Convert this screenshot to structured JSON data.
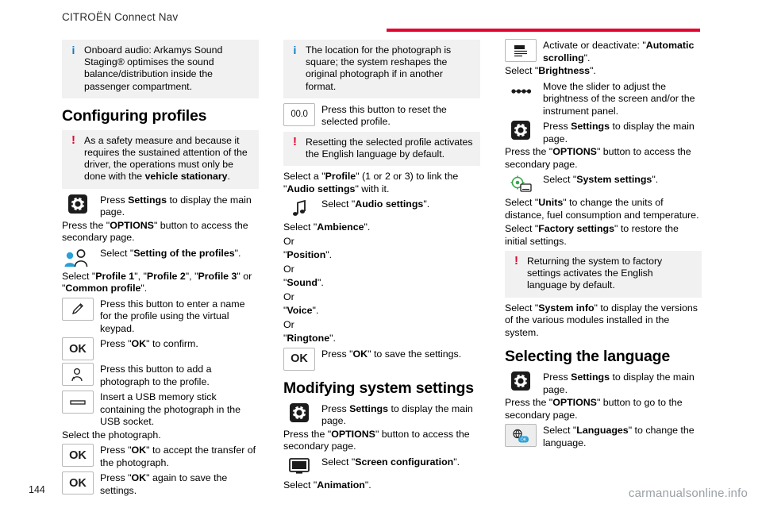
{
  "header": {
    "title": "CITROËN Connect Nav"
  },
  "footer": {
    "page_number": "144",
    "watermark": "carmanualsonline.info"
  },
  "col1": {
    "note_audio": "Onboard audio: Arkamys Sound Staging® optimises the sound balance/distribution inside the passenger compartment.",
    "heading_profiles": "Configuring profiles",
    "note_safety_pre": "As a safety measure and because it requires the sustained attention of the driver, the operations must only be done with the ",
    "note_safety_bold": "vehicle stationary",
    "note_safety_post": ".",
    "row_settings_pre": "Press ",
    "row_settings_bold": "Settings",
    "row_settings_post": " to display the main page.",
    "press_options_pre": "Press the \"",
    "press_options_bold": "OPTIONS",
    "press_options_post": "\" button to access the secondary page.",
    "row_profiles_pre": "Select \"",
    "row_profiles_bold": "Setting of the profiles",
    "row_profiles_post": "\".",
    "select_profile_pre": "Select \"",
    "select_profile_b1": "Profile 1",
    "select_profile_m1": "\", \"",
    "select_profile_b2": "Profile 2",
    "select_profile_m2": "\", \"",
    "select_profile_b3": "Profile 3",
    "select_profile_m3": "\" or \"",
    "select_profile_b4": "Common profile",
    "select_profile_end": "\".",
    "row_name": "Press this button to enter a name for the profile using the virtual keypad.",
    "row_ok1_pre": "Press \"",
    "row_ok1_bold": "OK",
    "row_ok1_post": "\" to confirm.",
    "row_photo": "Press this button to add a photograph to the profile.",
    "row_usb": "Insert a USB memory stick containing the photograph in the USB socket.",
    "select_photograph": "Select the photograph.",
    "row_ok2_pre": "Press \"",
    "row_ok2_bold": "OK",
    "row_ok2_post": "\" to accept the transfer of the photograph.",
    "row_ok3_pre": "Press \"",
    "row_ok3_bold": "OK",
    "row_ok3_post": "\" again to save the settings."
  },
  "col2": {
    "note_location": "The location for the photograph is square; the system reshapes the original photograph if in another format.",
    "row_reset": "Press this button to reset the selected profile.",
    "row_reset_label": "00.0",
    "note_reset": "Resetting the selected profile activates the English language by default.",
    "select_profile_pre": "Select a \"",
    "select_profile_b1": "Profile",
    "select_profile_mid": "\" (1 or 2 or 3) to link the \"",
    "select_profile_b2": "Audio settings",
    "select_profile_post": "\" with it.",
    "row_audio_pre": "Select \"",
    "row_audio_bold": "Audio settings",
    "row_audio_post": "\".",
    "select_ambience_pre": "Select \"",
    "select_ambience_bold": "Ambience",
    "select_ambience_post": "\".",
    "or1": "Or",
    "position_pre": "\"",
    "position_bold": "Position",
    "position_post": "\".",
    "or2": "Or",
    "sound_pre": "\"",
    "sound_bold": "Sound",
    "sound_post": "\".",
    "or3": "Or",
    "voice_pre": "\"",
    "voice_bold": "Voice",
    "voice_post": "\".",
    "or4": "Or",
    "ringtone_pre": "\"",
    "ringtone_bold": "Ringtone",
    "ringtone_post": "\".",
    "row_ok_pre": "Press \"",
    "row_ok_bold": "OK",
    "row_ok_post": "\" to save the settings.",
    "heading_system": "Modifying system settings",
    "row_settings_pre": "Press ",
    "row_settings_bold": "Settings",
    "row_settings_post": " to display the main page.",
    "press_options_pre": "Press the \"",
    "press_options_bold": "OPTIONS",
    "press_options_post": "\" button to access the secondary page.",
    "row_screen_pre": "Select \"",
    "row_screen_bold": "Screen configuration",
    "row_screen_post": "\".",
    "select_animation_pre": "Select \"",
    "select_animation_bold": "Animation",
    "select_animation_post": "\"."
  },
  "col3": {
    "row_scroll_pre": "Activate or deactivate: \"",
    "row_scroll_bold": "Automatic scrolling",
    "row_scroll_post": "\".",
    "select_brightness_pre": "Select \"",
    "select_brightness_bold": "Brightness",
    "select_brightness_post": "\".",
    "row_slider": "Move the slider to adjust the brightness of the screen and/or the instrument panel.",
    "row_settings_pre": "Press ",
    "row_settings_bold": "Settings",
    "row_settings_post": " to display the main page.",
    "press_options_pre": "Press the \"",
    "press_options_bold": "OPTIONS",
    "press_options_post": "\" button to access the secondary page.",
    "row_system_settings_pre": "Select \"",
    "row_system_settings_bold": "System settings",
    "row_system_settings_post": "\".",
    "select_units_pre": "Select \"",
    "select_units_bold": "Units",
    "select_units_post": "\" to change the units of distance, fuel consumption and temperature.",
    "select_factory_pre": "Select \"",
    "select_factory_bold": "Factory settings",
    "select_factory_post": "\" to restore the initial settings.",
    "note_factory": "Returning the system to factory settings activates the English language by default.",
    "select_sysinfo_pre": "Select \"",
    "select_sysinfo_bold": "System info",
    "select_sysinfo_post": "\" to display the versions of the various modules installed in the system.",
    "heading_language": "Selecting the language",
    "row_settings2_pre": "Press ",
    "row_settings2_bold": "Settings",
    "row_settings2_post": " to display the main page.",
    "press_options2_pre": "Press the \"",
    "press_options2_bold": "OPTIONS",
    "press_options2_post": "\" button to go to the secondary page.",
    "row_languages_pre": "Select \"",
    "row_languages_bold": "Languages",
    "row_languages_post": "\" to change the language."
  },
  "colors": {
    "accent_red": "#e3032e",
    "info_blue": "#0a7ec4",
    "note_bg": "#f1f1f1"
  }
}
